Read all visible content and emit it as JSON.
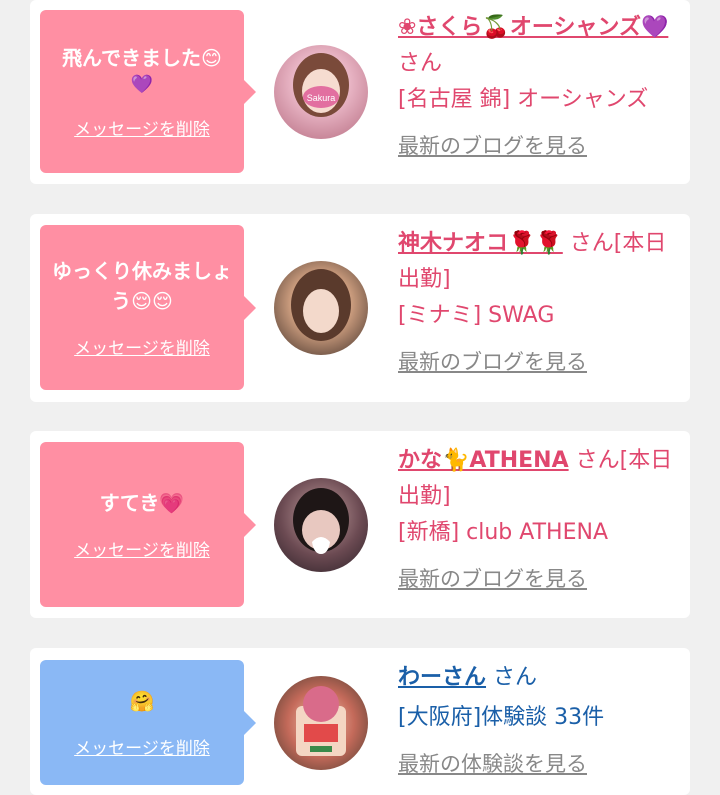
{
  "cards": [
    {
      "message": "飛んできました😊",
      "message_sub": "💜",
      "delete_label": "メッセージを削除",
      "name": "❀さくら🍒オーシャンズ💜",
      "san": "さん",
      "shop": "[名古屋 錦] オーシャンズ",
      "link": "最新のブログを見る",
      "avatar_label": "Sakura"
    },
    {
      "message": "ゆっくり休みましょう😌😌",
      "delete_label": "メッセージを削除",
      "name": "神木ナオコ🌹🌹",
      "san": "さん[本日出勤]",
      "shop": "[ミナミ] SWAG",
      "link": "最新のブログを見る"
    },
    {
      "message": "すてき💗",
      "delete_label": "メッセージを削除",
      "name": "かな🐈ATHENA",
      "san": "さん[本日出勤]",
      "shop": "[新橋] club ATHENA",
      "link": "最新のブログを見る"
    },
    {
      "message": "🤗",
      "delete_label": "メッセージを削除",
      "name": "わーさん",
      "san": "さん",
      "shop": "[大阪府]体験談 33件",
      "link": "最新の体験談を見る"
    }
  ],
  "colors": {
    "pink_bubble": "#ff8fa3",
    "blue_bubble": "#8ab8f5",
    "pink_text": "#e0476e",
    "blue_text": "#1a5fa8",
    "link_gray": "#888888"
  }
}
